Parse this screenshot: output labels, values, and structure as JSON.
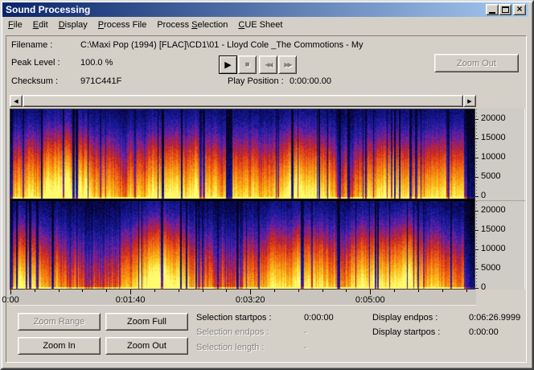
{
  "window": {
    "title": "Sound Processing"
  },
  "window_buttons": {
    "minimize": "minimize",
    "maximize": "maximize",
    "close": "close"
  },
  "menu": {
    "items": [
      {
        "label": "File",
        "mnemonic": 0
      },
      {
        "label": "Edit",
        "mnemonic": 0
      },
      {
        "label": "Display",
        "mnemonic": 0
      },
      {
        "label": "Process File",
        "mnemonic": 0
      },
      {
        "label": "Process Selection",
        "mnemonic": 8
      },
      {
        "label": "CUE Sheet",
        "mnemonic": 0
      }
    ]
  },
  "info": {
    "filename_label": "Filename :",
    "filename_value": "C:\\Maxi Pop (1994) [FLAC]\\CD1\\01 - Lloyd Cole _The Commotions - My",
    "peak_level_label": "Peak Level :",
    "peak_level_value": "100.0 %",
    "checksum_label": "Checksum :",
    "checksum_value": "971C441F",
    "play_position_label": "Play Position :",
    "play_position_value": "0:00:00.00"
  },
  "transport": {
    "play": "play",
    "stop": "stop",
    "rewind": "rewind",
    "fast_forward": "fast-forward"
  },
  "top_controls": {
    "zoom_out_label": "Zoom Out",
    "zoom_out_enabled": false
  },
  "spectrogram": {
    "channels": 2,
    "freq_axis_ticks": [
      20000,
      15000,
      10000,
      5000,
      0
    ],
    "time_axis": {
      "duration_seconds": 387,
      "major_tick_interval_seconds": 100,
      "minor_tick_interval_seconds": 20,
      "labels": [
        {
          "text": "0:00",
          "seconds": 0
        },
        {
          "text": "0:01:40",
          "seconds": 100
        },
        {
          "text": "0:03:20",
          "seconds": 200
        },
        {
          "text": "0:05:00",
          "seconds": 300
        }
      ]
    },
    "colormap": [
      "#020208",
      "#08085a",
      "#1d1ea8",
      "#7a1f9e",
      "#c22222",
      "#e84b16",
      "#f58711",
      "#fbc81e",
      "#fffa6e"
    ]
  },
  "bottom_controls": {
    "zoom_range": {
      "label": "Zoom Range",
      "enabled": false
    },
    "zoom_full": {
      "label": "Zoom Full",
      "enabled": true
    },
    "zoom_in": {
      "label": "Zoom In",
      "enabled": true
    },
    "zoom_out": {
      "label": "Zoom Out",
      "enabled": true
    }
  },
  "status": {
    "selection_startpos_label": "Selection startpos :",
    "selection_startpos_value": "0:00:00",
    "selection_endpos_label": "Selection endpos :",
    "selection_endpos_value": "-",
    "selection_length_label": "Selection length :",
    "selection_length_value": "-",
    "display_endpos_label": "Display endpos :",
    "display_endpos_value": "0:06:26.9999",
    "display_startpos_label": "Display startpos :",
    "display_startpos_value": "0:00:00"
  },
  "colors": {
    "titlebar_left": "#0a246a",
    "titlebar_right": "#a6caf0",
    "chrome": "#d4d0c8",
    "disabled_text": "#84807a"
  }
}
